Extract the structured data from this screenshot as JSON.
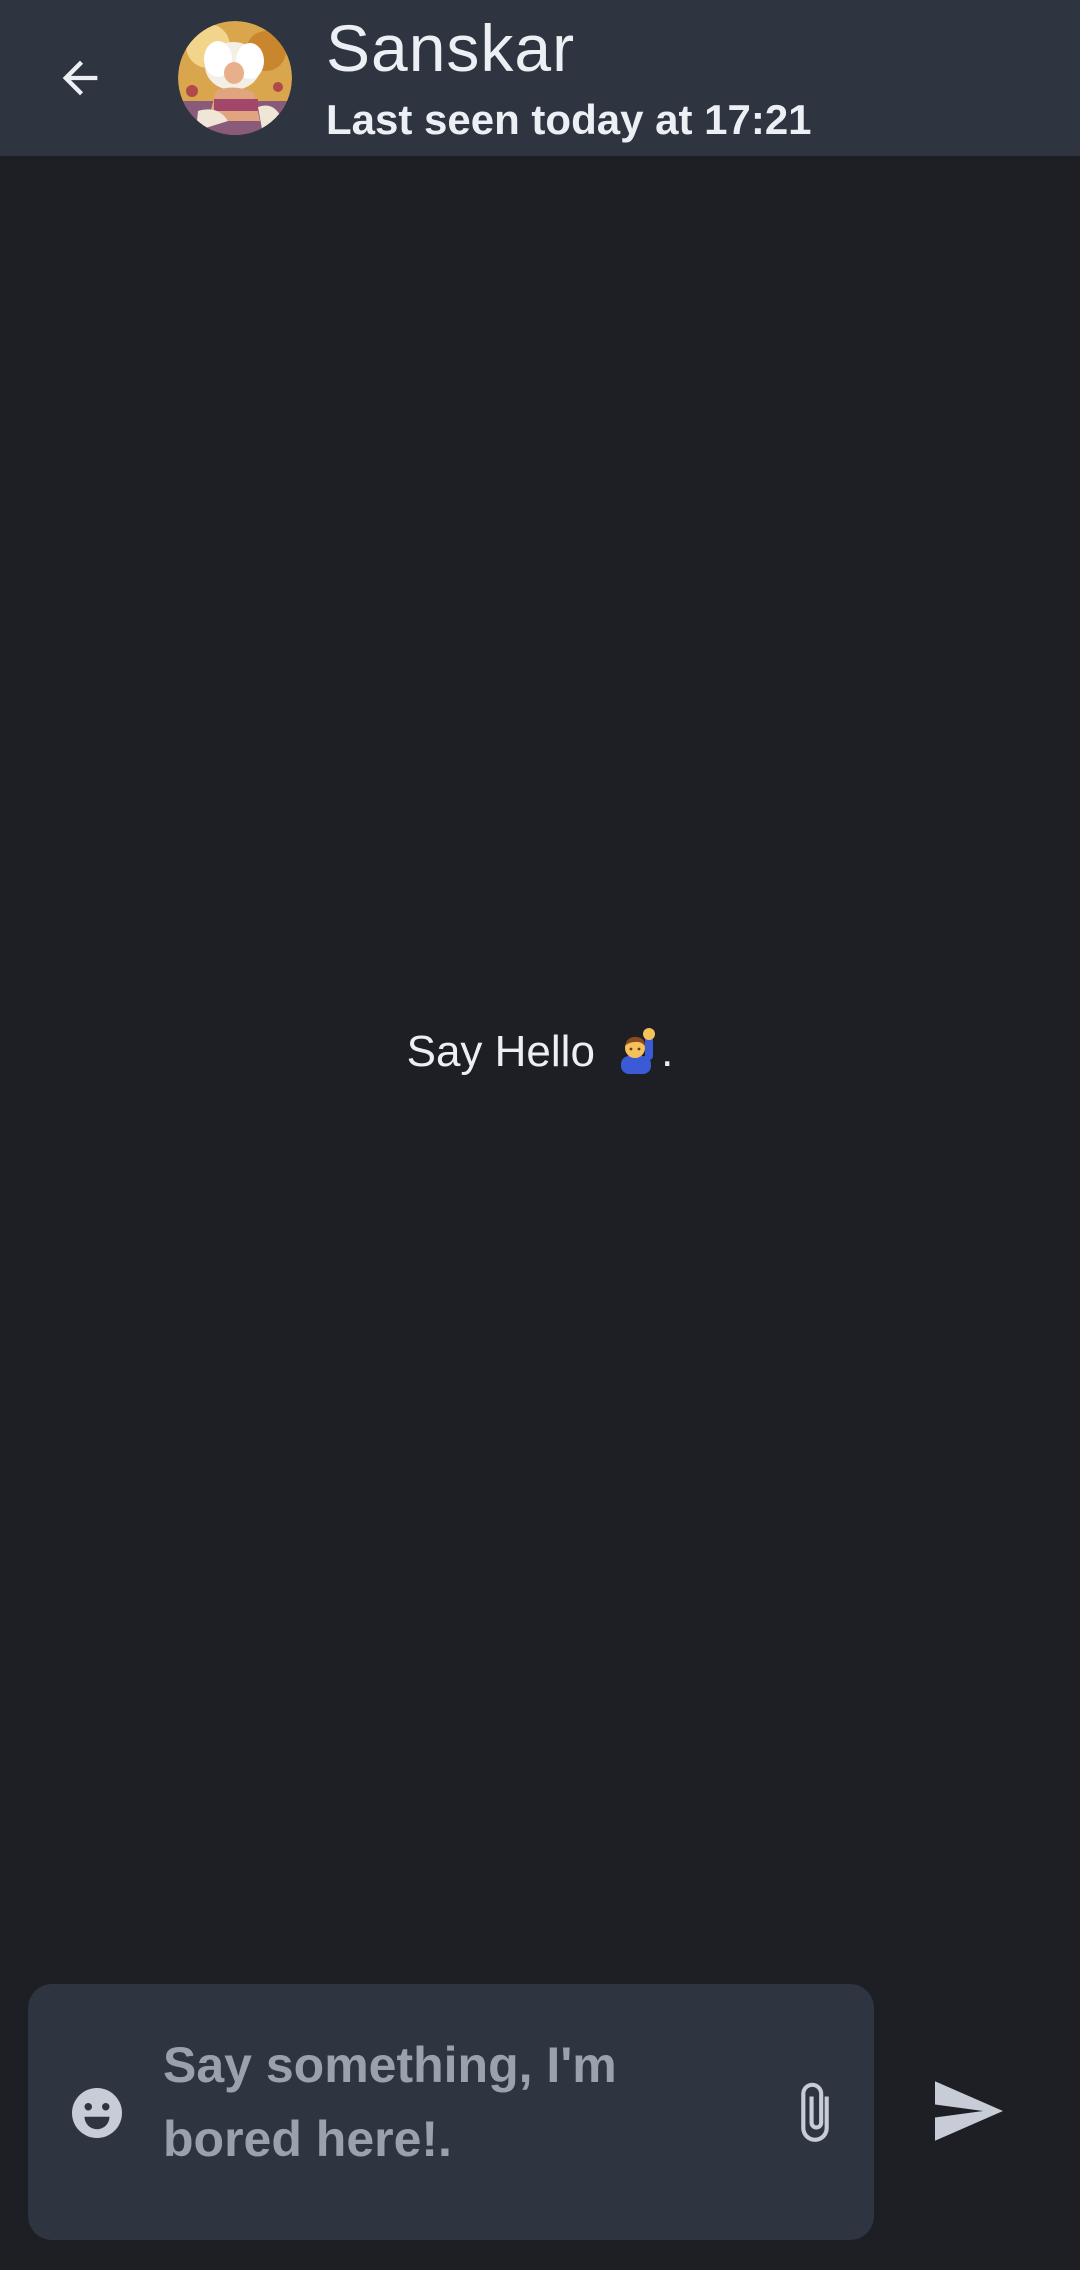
{
  "header": {
    "contact_name": "Sanskar",
    "last_seen": "Last seen today at 17:21",
    "back_icon": "arrow-left-icon",
    "avatar_icon": "avatar-icon"
  },
  "chat": {
    "empty_text": "Say Hello ",
    "empty_suffix": ".",
    "empty_icon": "person-raising-hand-emoji"
  },
  "composer": {
    "placeholder": "Say something, I'm bored here!.",
    "emoji_icon": "emoji-smile-icon",
    "attach_icon": "paperclip-icon",
    "send_icon": "send-icon"
  },
  "colors": {
    "background": "#1d1f24",
    "appbar": "#2e3440",
    "text": "#eceff4",
    "placeholder": "#9aa1ad",
    "icon": "#c8ccd6"
  }
}
